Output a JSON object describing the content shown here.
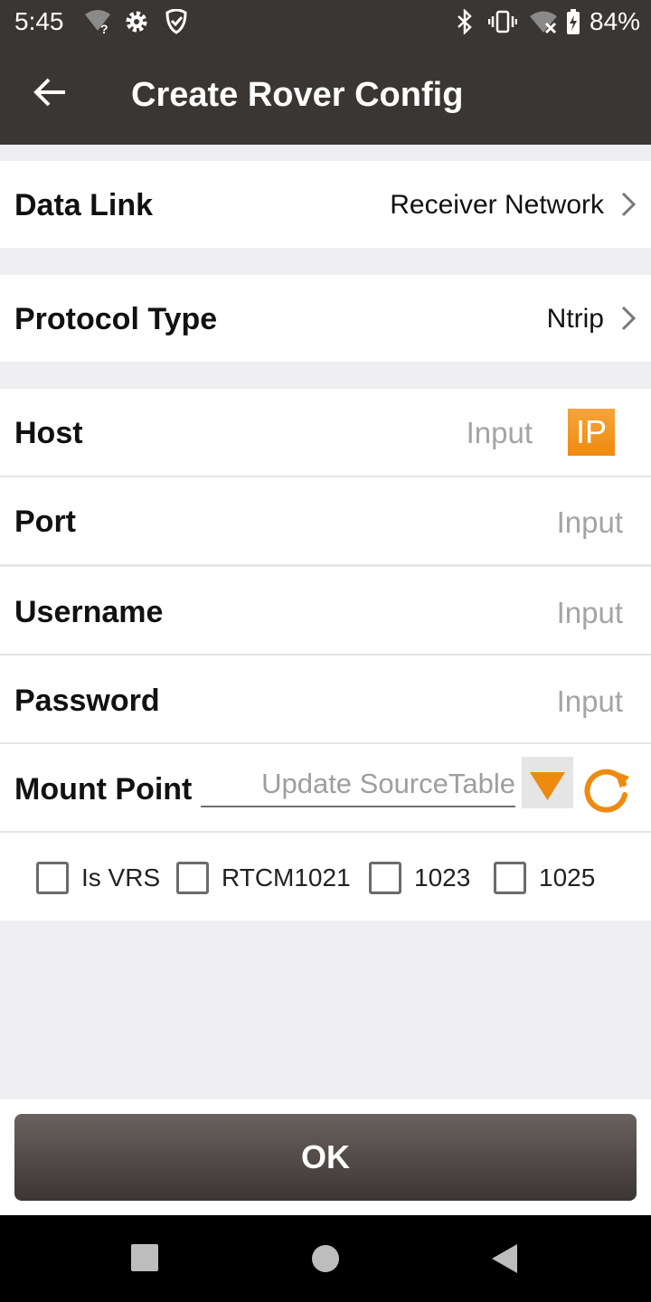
{
  "status_bar": {
    "time": "5:45",
    "battery": "84%",
    "icons": [
      "wifi-question-icon",
      "gear-icon",
      "shield-icon",
      "bluetooth-icon",
      "vibrate-icon",
      "wifi-off-icon",
      "battery-charging-icon"
    ]
  },
  "app_bar": {
    "title": "Create Rover Config",
    "back_icon": "arrow-left-icon"
  },
  "data_link": {
    "label": "Data Link",
    "value": "Receiver Network"
  },
  "protocol_type": {
    "label": "Protocol Type",
    "value": "Ntrip"
  },
  "host": {
    "label": "Host",
    "placeholder": "Input",
    "ip_button": "IP"
  },
  "port": {
    "label": "Port",
    "placeholder": "Input"
  },
  "username": {
    "label": "Username",
    "placeholder": "Input"
  },
  "password": {
    "label": "Password",
    "placeholder": "Input"
  },
  "mount_point": {
    "label": "Mount Point",
    "placeholder": "Update SourceTable"
  },
  "checkboxes": [
    {
      "label": "Is VRS",
      "checked": false
    },
    {
      "label": "RTCM1021",
      "checked": false
    },
    {
      "label": "1023",
      "checked": false
    },
    {
      "label": "1025",
      "checked": false
    }
  ],
  "ok_button": "OK",
  "colors": {
    "bar": "#3a3634",
    "accent": "#ef8a10",
    "background": "#efeff2"
  }
}
